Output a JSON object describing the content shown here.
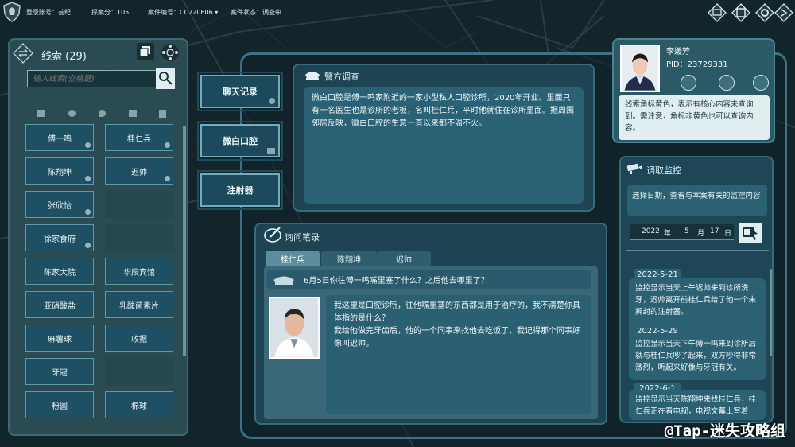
{
  "topbar": {
    "login_label": "登录账号：",
    "login_value": "芸纪",
    "score_label": "探案分：",
    "score_value": "105",
    "case_label": "案件编号：",
    "case_value": "CC220606",
    "status_label": "案件状态：",
    "status_value": "调查中",
    "icons": [
      "monitor-icon",
      "window-icon",
      "settings-icon",
      "exit-icon"
    ]
  },
  "clues": {
    "title": "线索 (29)",
    "search_placeholder": "输入线索(空格键)",
    "items": [
      {
        "label": "傅一鸣",
        "marked": true
      },
      {
        "label": "桂仁兵",
        "marked": true
      },
      {
        "label": "陈翔坤",
        "marked": true
      },
      {
        "label": "迟帅",
        "marked": true
      },
      {
        "label": "张欣怡",
        "marked": true
      },
      {
        "label": "",
        "marked": false
      },
      {
        "label": "徐家食府",
        "marked": true
      },
      {
        "label": "",
        "marked": false
      },
      {
        "label": "陈家大院",
        "marked": false
      },
      {
        "label": "华辰宾馆",
        "marked": false
      },
      {
        "label": "亚硝酸盐",
        "marked": false
      },
      {
        "label": "乳酸菌素片",
        "marked": false
      },
      {
        "label": "麻薯球",
        "marked": false
      },
      {
        "label": "收据",
        "marked": false
      },
      {
        "label": "牙冠",
        "marked": false
      },
      {
        "label": "",
        "marked": false
      },
      {
        "label": "粉圆",
        "marked": false
      },
      {
        "label": "棉球",
        "marked": false
      }
    ]
  },
  "side_tabs": [
    "聊天记录",
    "微白口腔",
    "注射器"
  ],
  "police": {
    "title": "警方调查",
    "text": "微白口腔是傅一鸣家附近的一家小型私人口腔诊所，2020年开业。里面只有一名医生也是诊所的老板，名叫桂仁兵，平时他就住在诊所里面。据周围邻居反映，微白口腔的生意一直以来都不温不火。"
  },
  "interrogation": {
    "title": "询问笔录",
    "tabs": [
      "桂仁兵",
      "陈翔坤",
      "迟帅"
    ],
    "question": "6月5日你往傅一鸣嘴里塞了什么？之后他去哪里了？",
    "answer_1": "我这里是口腔诊所，往他嘴里塞的东西都是用于治疗的，我不清楚你具体指的是什么？",
    "answer_2": "我给他做完牙齿后，他的一个同事来找他去吃饭了，我记得那个同事好像叫迟帅。"
  },
  "profile": {
    "name": "李媛芳",
    "pid": "PID：23729331",
    "hint": "线索角标黄色，表示有核心内容未查询到。需注意，角标非黄色也可以查询内容。"
  },
  "monitor": {
    "title": "调取监控",
    "hint": "选择日期，查看与本案有关的监控内容",
    "date": {
      "year": "2022",
      "year_unit": "年",
      "month": "5",
      "month_unit": "月",
      "day": "17",
      "day_unit": "日"
    },
    "entries": [
      {
        "date": "2022-5-21",
        "text": "监控显示当天上午迟帅来到诊所洗牙，迟帅离开前桂仁兵给了他一个未拆封的注射器。"
      },
      {
        "date": "2022-5-29",
        "text": "监控显示当天下午傅一鸣来到诊所后就与桂仁兵吵了起来，双方吵得非常激烈，听起来好像与牙冠有关。"
      },
      {
        "date": "2022-6-1",
        "text": "监控显示当天陈翔坤来找桂仁兵，桂仁兵正在看电视，电视文幕上写着"
      }
    ]
  },
  "watermark": "@Tap-迷失攻略组"
}
